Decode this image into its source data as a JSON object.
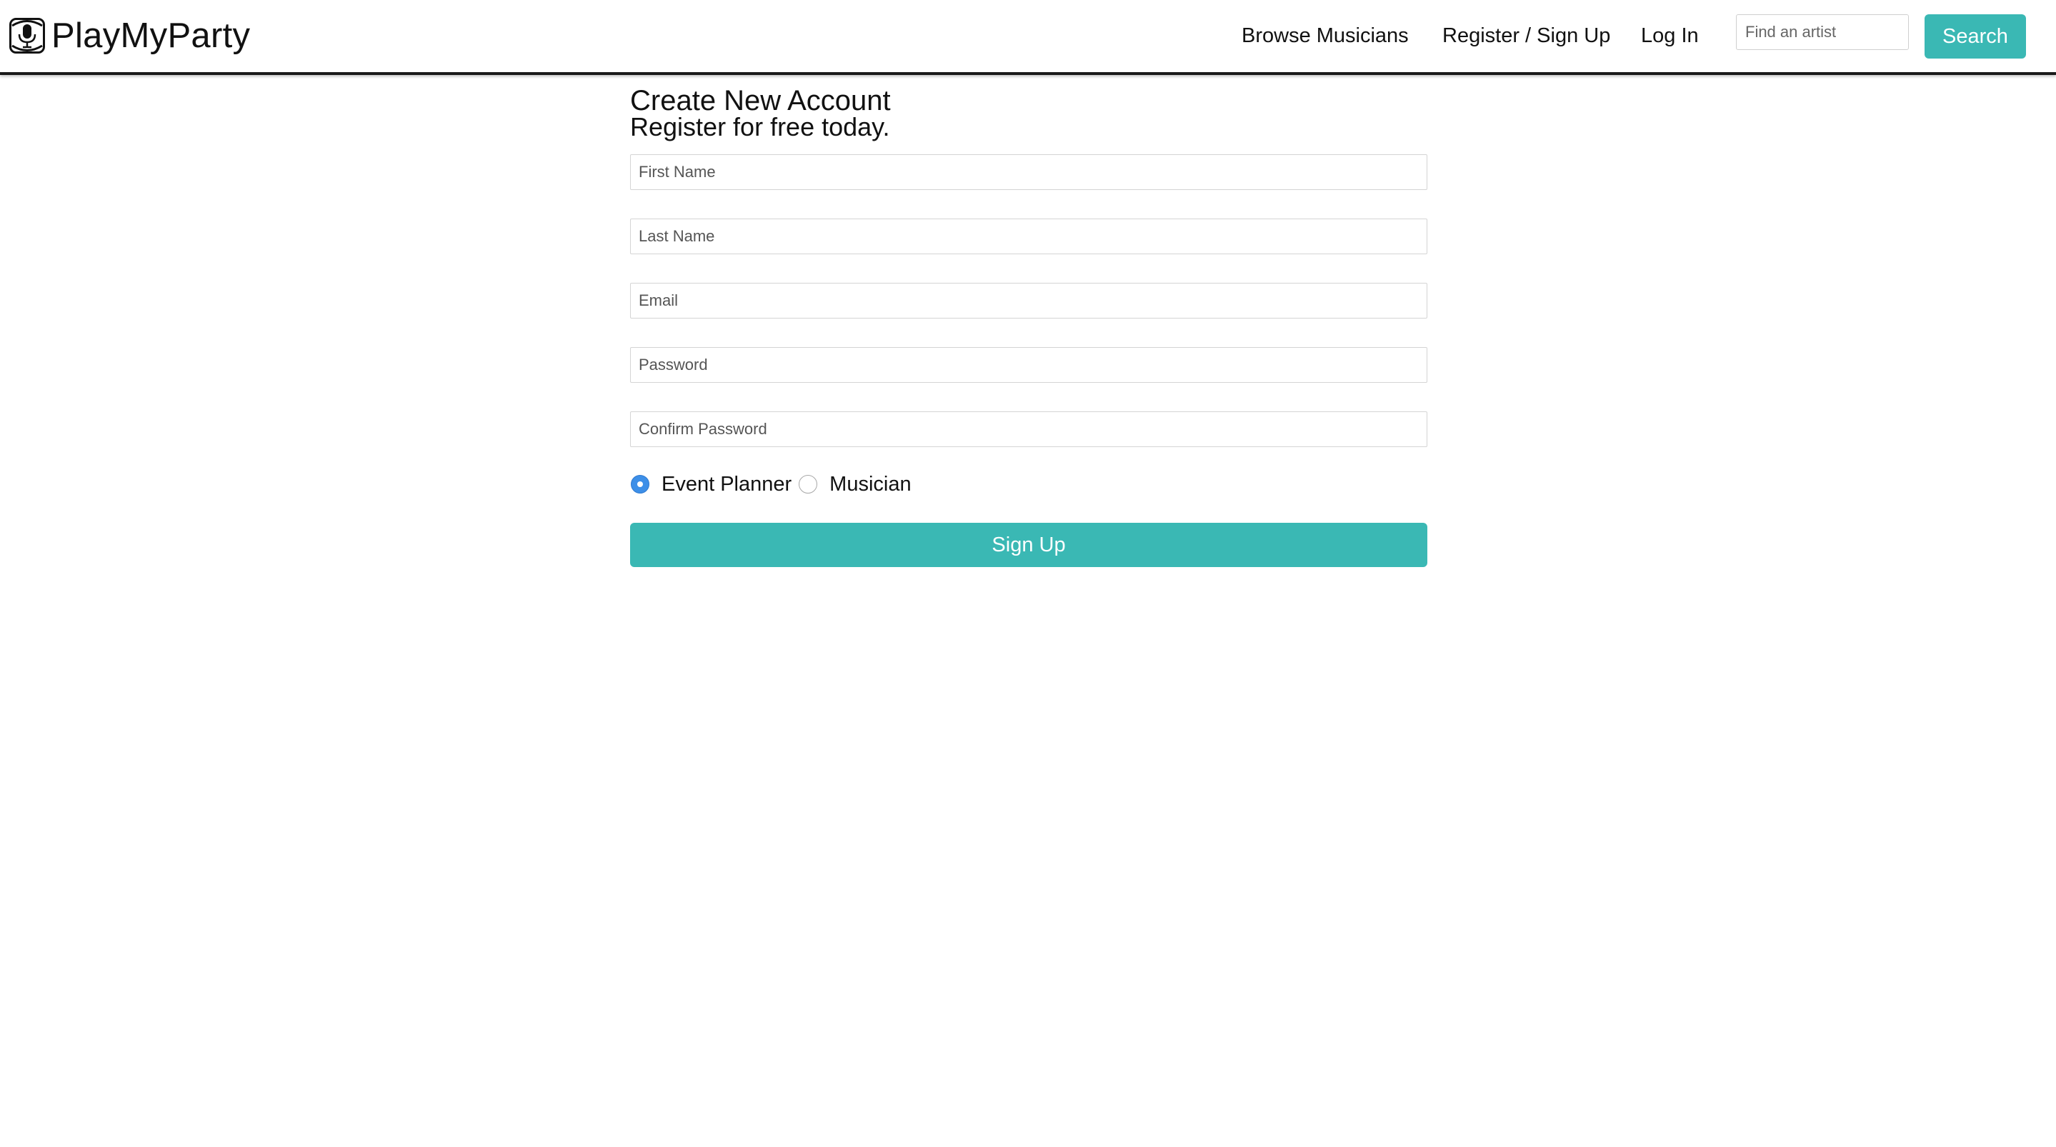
{
  "app": {
    "brand_name": "PlayMyParty",
    "logo_icon": "microphone-icon"
  },
  "nav": {
    "items": [
      {
        "label": "Browse Musicians"
      },
      {
        "label": "Register / Sign Up"
      },
      {
        "label": "Log In"
      }
    ],
    "search": {
      "placeholder": "Find an artist",
      "value": "",
      "button_label": "Search"
    }
  },
  "form": {
    "title": "Create New Account",
    "subtitle": "Register for free today.",
    "fields": {
      "first_name": {
        "placeholder": "First Name",
        "value": ""
      },
      "last_name": {
        "placeholder": "Last Name",
        "value": ""
      },
      "email": {
        "placeholder": "Email",
        "value": ""
      },
      "password": {
        "placeholder": "Password",
        "value": ""
      },
      "confirm_password": {
        "placeholder": "Confirm Password",
        "value": ""
      }
    },
    "roles": [
      {
        "label": "Event Planner",
        "selected": true
      },
      {
        "label": "Musician",
        "selected": false
      }
    ],
    "submit_label": "Sign Up"
  },
  "colors": {
    "accent": "#3ab8b4",
    "radio_selected": "#3d8fe8",
    "nav_border": "#1a1a1a"
  }
}
